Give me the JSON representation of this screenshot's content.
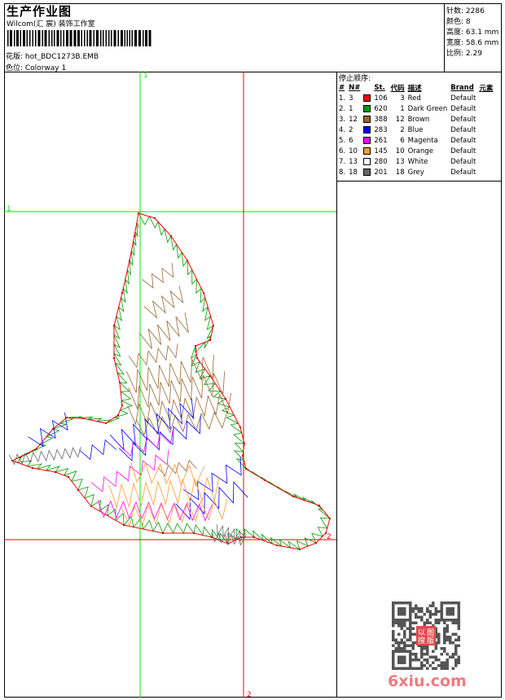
{
  "header": {
    "title": "生产作业图",
    "company": "Wilcom(汇 宸) 装饰工作室",
    "design_label": "花版: hot_BDC1273B.EMB",
    "colorway_label": "色位: Colorway 1"
  },
  "info": {
    "stitches": "针数: 2286",
    "colors": "颜色: 8",
    "height": "高度: 63.1 mm",
    "width": "宽度: 58.6 mm",
    "scale": "比例: 2.29"
  },
  "stop_sequence": {
    "title": "停止顺序:",
    "headers": [
      "#",
      "N#",
      "",
      "St.",
      "代码",
      "描述",
      "Brand",
      "元素"
    ],
    "rows": [
      {
        "idx": "1.",
        "n": "3",
        "color": "#ff0000",
        "st": "106",
        "code": "3",
        "desc": "Red",
        "brand": "Default"
      },
      {
        "idx": "2.",
        "n": "1",
        "color": "#009900",
        "st": "620",
        "code": "1",
        "desc": "Dark Green",
        "brand": "Default"
      },
      {
        "idx": "3.",
        "n": "12",
        "color": "#996633",
        "st": "388",
        "code": "12",
        "desc": "Brown",
        "brand": "Default"
      },
      {
        "idx": "4.",
        "n": "2",
        "color": "#0000ff",
        "st": "283",
        "code": "2",
        "desc": "Blue",
        "brand": "Default"
      },
      {
        "idx": "5.",
        "n": "6",
        "color": "#ff00ff",
        "st": "261",
        "code": "6",
        "desc": "Magenta",
        "brand": "Default"
      },
      {
        "idx": "6.",
        "n": "10",
        "color": "#ff9933",
        "st": "145",
        "code": "10",
        "desc": "Orange",
        "brand": "Default"
      },
      {
        "idx": "7.",
        "n": "13",
        "color": "#ffffff",
        "st": "280",
        "code": "13",
        "desc": "White",
        "brand": "Default"
      },
      {
        "idx": "8.",
        "n": "18",
        "color": "#666666",
        "st": "201",
        "code": "18",
        "desc": "Grey",
        "brand": "Default"
      }
    ]
  },
  "guides": {
    "start_label": "1",
    "end_label": "2",
    "start_color": "#00ee00",
    "end_color": "#ff0000"
  },
  "watermark": {
    "logo_text": "6xiu.com",
    "seal_text": "以图搜版"
  }
}
